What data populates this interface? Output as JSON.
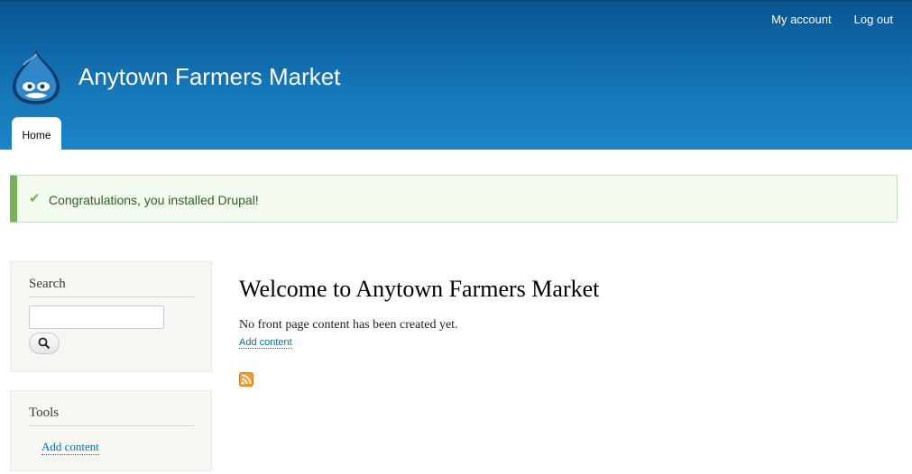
{
  "header": {
    "secondary_menu": [
      {
        "label": "My account"
      },
      {
        "label": "Log out"
      }
    ],
    "site_name": "Anytown Farmers Market",
    "logo_icon": "drupal-drop-icon",
    "tabs": [
      {
        "label": "Home",
        "active": true
      }
    ]
  },
  "message": {
    "icon": "check-icon",
    "text": "Congratulations, you installed Drupal!"
  },
  "sidebar": {
    "search": {
      "title": "Search",
      "input_value": "",
      "button_icon": "search-icon"
    },
    "tools": {
      "title": "Tools",
      "links": [
        {
          "label": "Add content"
        }
      ]
    }
  },
  "main": {
    "title": "Welcome to Anytown Farmers Market",
    "empty_text": "No front page content has been created yet.",
    "add_content_label": "Add content",
    "feed_icon": "rss-feed-icon"
  },
  "colors": {
    "header_top": "#0a5593",
    "header_bottom": "#1d84c6",
    "message_accent": "#77b259",
    "link": "#0071b3",
    "feed": "#f89a2a"
  }
}
